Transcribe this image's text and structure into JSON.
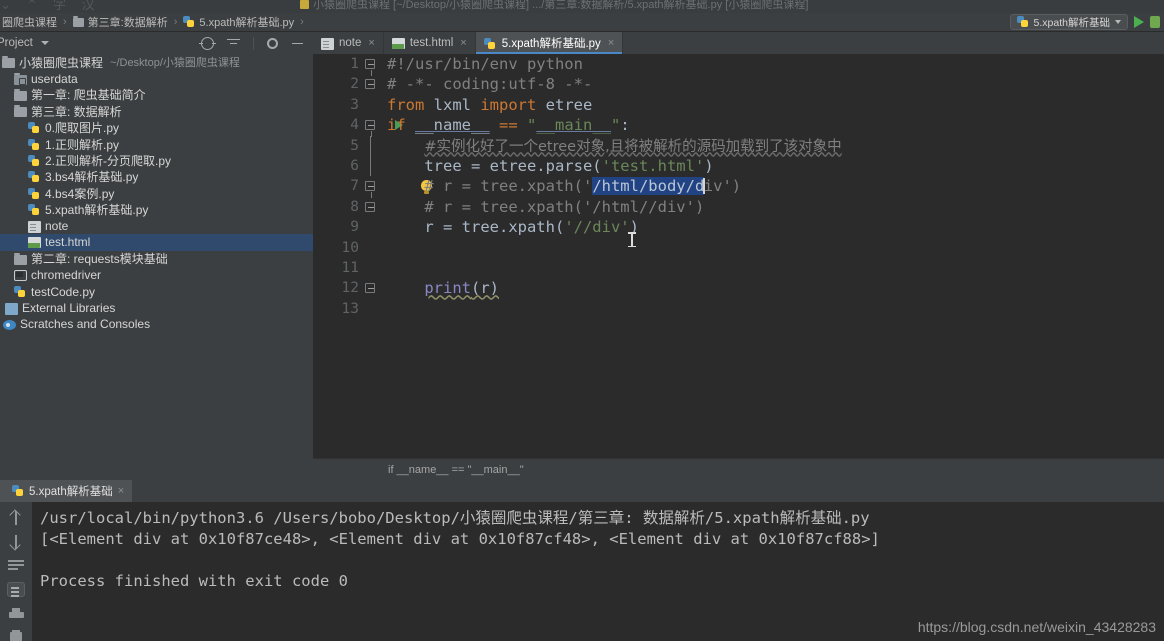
{
  "window": {
    "title_ghost": "小猿圈爬虫课程 [~/Desktop/小猿圈爬虫课程] .../第三章:数据解析/5.xpath解析基础.py [小猿圈爬虫课程]"
  },
  "navbar": {
    "breadcrumbs": [
      {
        "label": "圈爬虫课程",
        "icon": "folder-icon"
      },
      {
        "label": "第三章:数据解析",
        "icon": "folder-icon"
      },
      {
        "label": "5.xpath解析基础.py",
        "icon": "python-file-icon"
      }
    ],
    "run_config": "5.xpath解析基础",
    "run_button": "run-icon",
    "debug_button": "debug-icon"
  },
  "project_panel": {
    "title": "Project",
    "tools": [
      "target-icon",
      "collapse-all-icon",
      "gear-icon",
      "minimize-icon"
    ],
    "tree": [
      {
        "label": "小猿圈爬虫课程",
        "path": "~/Desktop/小猿圈爬虫课程",
        "icon": "project-folder-icon",
        "indent": 1,
        "selected": false
      },
      {
        "label": "userdata",
        "path": "",
        "icon": "source-folder-icon",
        "indent": 2,
        "selected": false
      },
      {
        "label": "第一章: 爬虫基础简介",
        "path": "",
        "icon": "folder-icon",
        "indent": 2,
        "selected": false
      },
      {
        "label": "第三章: 数据解析",
        "path": "",
        "icon": "folder-icon",
        "indent": 2,
        "selected": false
      },
      {
        "label": "0.爬取图片.py",
        "path": "",
        "icon": "python-file-icon",
        "indent": 3,
        "selected": false
      },
      {
        "label": "1.正则解析.py",
        "path": "",
        "icon": "python-file-icon",
        "indent": 3,
        "selected": false
      },
      {
        "label": "2.正则解析-分页爬取.py",
        "path": "",
        "icon": "python-file-icon",
        "indent": 3,
        "selected": false
      },
      {
        "label": "3.bs4解析基础.py",
        "path": "",
        "icon": "python-file-icon",
        "indent": 3,
        "selected": false
      },
      {
        "label": "4.bs4案例.py",
        "path": "",
        "icon": "python-file-icon",
        "indent": 3,
        "selected": false
      },
      {
        "label": "5.xpath解析基础.py",
        "path": "",
        "icon": "python-file-icon",
        "indent": 3,
        "selected": false
      },
      {
        "label": "note",
        "path": "",
        "icon": "note-file-icon",
        "indent": 3,
        "selected": false
      },
      {
        "label": "test.html",
        "path": "",
        "icon": "html-file-icon",
        "indent": 3,
        "selected": true
      },
      {
        "label": "第二章: requests模块基础",
        "path": "",
        "icon": "folder-icon",
        "indent": 2,
        "selected": false
      },
      {
        "label": "chromedriver",
        "path": "",
        "icon": "binary-file-icon",
        "indent": 2,
        "selected": false
      },
      {
        "label": "testCode.py",
        "path": "",
        "icon": "python-file-icon",
        "indent": 2,
        "selected": false
      },
      {
        "label": "External Libraries",
        "path": "",
        "icon": "library-icon",
        "indent": 1,
        "selected": false
      },
      {
        "label": "Scratches and Consoles",
        "path": "",
        "icon": "scratches-icon",
        "indent": 1,
        "selected": false
      }
    ]
  },
  "editor": {
    "tabs": [
      {
        "label": "note",
        "icon": "note-file-icon",
        "active": false
      },
      {
        "label": "test.html",
        "icon": "html-file-icon",
        "active": false
      },
      {
        "label": "5.xpath解析基础.py",
        "icon": "python-file-icon",
        "active": true
      }
    ],
    "close_glyph": "×",
    "breadcrumb": "if __name__ == \"__main__\"",
    "lines": [
      {
        "no": "1",
        "text": "#!/usr/bin/env python"
      },
      {
        "no": "2",
        "text": "# -*- coding:utf-8 -*-"
      },
      {
        "no": "3",
        "text": "from lxml import etree"
      },
      {
        "no": "4",
        "text": "if __name__ == \"__main__\":"
      },
      {
        "no": "5",
        "text": "    #实例化好了一个etree对象,且将被解析的源码加载到了该对象中"
      },
      {
        "no": "6",
        "text": "    tree = etree.parse('test.html')"
      },
      {
        "no": "7",
        "text": "    # r = tree.xpath('/html/body/div')"
      },
      {
        "no": "8",
        "text": "    # r = tree.xpath('/html//div')"
      },
      {
        "no": "9",
        "text": "    r = tree.xpath('//div')"
      },
      {
        "no": "10",
        "text": ""
      },
      {
        "no": "11",
        "text": ""
      },
      {
        "no": "12",
        "text": "    print(r)"
      },
      {
        "no": "13",
        "text": ""
      }
    ],
    "selection": "/html/body/d"
  },
  "run_window": {
    "tab_label": "5.xpath解析基础",
    "close_glyph": "×",
    "side_icons": [
      "arrow-up-icon",
      "arrow-down-icon",
      "soft-wrap-icon",
      "scroll-to-end-icon",
      "print-icon",
      "trash-icon"
    ],
    "output": [
      "/usr/local/bin/python3.6 /Users/bobo/Desktop/小猿圈爬虫课程/第三章: 数据解析/5.xpath解析基础.py",
      "[<Element div at 0x10f87ce48>, <Element div at 0x10f87cf48>, <Element div at 0x10f87cf88>]",
      "",
      "Process finished with exit code 0"
    ]
  },
  "watermark": "https://blog.csdn.net/weixin_43428283",
  "colors": {
    "accent": "#4a88c7",
    "selection": "#214283",
    "keyword": "#cc7832",
    "string": "#6a8759",
    "comment": "#808080",
    "editor_bg": "#2b2b2b",
    "chrome_bg": "#3c3f41",
    "tree_selected": "#2f4a6d",
    "run_green": "#4caf50"
  }
}
